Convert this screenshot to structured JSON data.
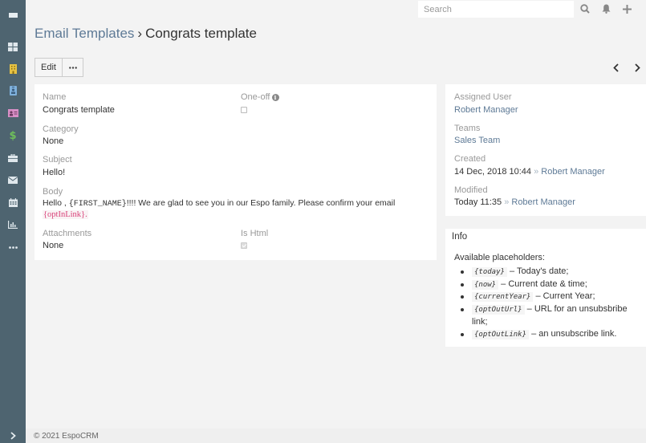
{
  "sidebar": {
    "menu_icon": "hamburger-icon",
    "items": [
      {
        "name": "dashboard",
        "icon": "grid-icon",
        "color": "#dfe7ec"
      },
      {
        "name": "accounts",
        "icon": "building-icon",
        "color": "#e6c244"
      },
      {
        "name": "contacts",
        "icon": "id-badge-icon",
        "color": "#7fb1dc"
      },
      {
        "name": "leads",
        "icon": "address-card-icon",
        "color": "#d88fc6"
      },
      {
        "name": "opportunities",
        "icon": "dollar-icon",
        "color": "#6fbf5a"
      },
      {
        "name": "cases",
        "icon": "briefcase-icon",
        "color": "#dfe7ec"
      },
      {
        "name": "emails",
        "icon": "envelope-icon",
        "color": "#dfe7ec"
      },
      {
        "name": "calendar",
        "icon": "calendar-icon",
        "color": "#dfe7ec"
      },
      {
        "name": "reports",
        "icon": "bar-chart-icon",
        "color": "#dfe7ec"
      },
      {
        "name": "more",
        "icon": "ellipsis-icon",
        "color": "#dfe7ec"
      }
    ],
    "expand_icon": "chevron-right-icon"
  },
  "topbar": {
    "search_placeholder": "Search",
    "icons": [
      "search-icon",
      "bell-icon",
      "plus-icon"
    ]
  },
  "header": {
    "breadcrumb_parent": "Email Templates",
    "separator": "›",
    "title": "Congrats template"
  },
  "toolbar": {
    "edit_label": "Edit",
    "more_label": "•••"
  },
  "record": {
    "name_label": "Name",
    "name_value": "Congrats template",
    "oneoff_label": "One-off",
    "oneoff_checked": false,
    "category_label": "Category",
    "category_value": "None",
    "subject_label": "Subject",
    "subject_value": "Hello!",
    "body_label": "Body",
    "body_part1": "Hello , ",
    "body_placeholder1": "{FIRST_NAME}",
    "body_part2": "!!!! We are glad to see you in our Espo family. Please confirm your email ",
    "body_placeholder2": "{optInLink}.",
    "attachments_label": "Attachments",
    "attachments_value": "None",
    "is_html_label": "Is Html",
    "is_html_checked": true
  },
  "side": {
    "assigned_user_label": "Assigned User",
    "assigned_user_value": "Robert Manager",
    "teams_label": "Teams",
    "teams_value": "Sales Team",
    "created_label": "Created",
    "created_date": "14 Dec, 2018 10:44",
    "created_by": "Robert Manager",
    "modified_label": "Modified",
    "modified_date": "Today 11:35",
    "modified_by": "Robert Manager",
    "arrow": "»"
  },
  "info": {
    "title": "Info",
    "intro": "Available placeholders:",
    "items": [
      {
        "code": "{today}",
        "text": " – Today's date;"
      },
      {
        "code": "{now}",
        "text": " – Current date & time;"
      },
      {
        "code": "{currentYear}",
        "text": " – Current Year;"
      },
      {
        "code": "{optOutUrl}",
        "text": " – URL for an unsubsbribe link;"
      },
      {
        "code": "{optOutLink}",
        "text": " – an unsubscribe link."
      }
    ]
  },
  "footer": {
    "text": "© 2021 EspoCRM"
  }
}
